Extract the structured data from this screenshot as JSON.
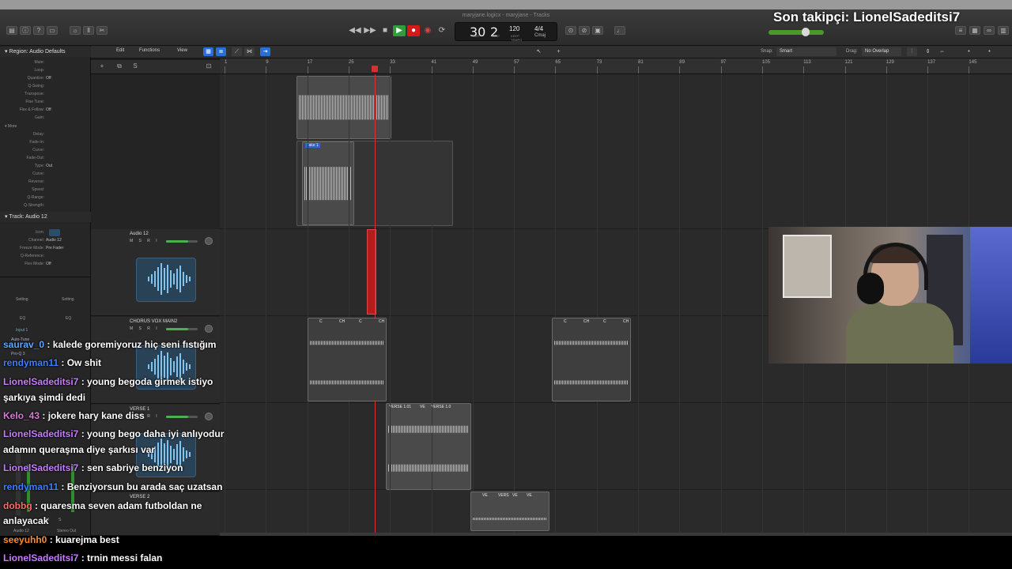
{
  "window": {
    "title": "maryjane.logicx - maryjane - Tracks",
    "apple_glyph": ""
  },
  "stream": {
    "follower_label": "Son takipçi: LionelSadeditsi7"
  },
  "lcd": {
    "bar": "30",
    "beat": "2",
    "bar_label": "BAR",
    "beat_label": "BEAT",
    "tempo": "120",
    "tempo_label": "KEEP",
    "tempo_sub": "TEMPO",
    "signature": "4/4",
    "key": "Cmaj"
  },
  "local_menu": {
    "edit": "Edit",
    "functions": "Functions",
    "view": "View",
    "snap_label": "Snap:",
    "snap_value": "Smart",
    "drag_label": "Drag:",
    "drag_value": "No Overlap"
  },
  "inspector": {
    "region_header": "Region: Audio Defaults",
    "region_rows": [
      {
        "k": "Mute:",
        "v": ""
      },
      {
        "k": "Loop:",
        "v": ""
      },
      {
        "k": "Quantize:",
        "v": "Off"
      },
      {
        "k": "Q-Swing:",
        "v": ""
      },
      {
        "k": "Transpose:",
        "v": ""
      },
      {
        "k": "Fine Tune:",
        "v": ""
      },
      {
        "k": "Flex & Follow:",
        "v": "Off"
      },
      {
        "k": "Gain:",
        "v": ""
      }
    ],
    "more": "More",
    "more_rows": [
      {
        "k": "Delay:",
        "v": ""
      },
      {
        "k": "Fade-In:",
        "v": ""
      },
      {
        "k": "Curve:",
        "v": ""
      },
      {
        "k": "Fade-Out:",
        "v": ""
      },
      {
        "k": "Type:",
        "v": "Out"
      },
      {
        "k": "Curve:",
        "v": ""
      },
      {
        "k": "Reverse:",
        "v": ""
      },
      {
        "k": "Speed:",
        "v": ""
      },
      {
        "k": "Q-Range:",
        "v": ""
      },
      {
        "k": "Q-Strength:",
        "v": ""
      }
    ],
    "track_header": "Track: Audio 12",
    "track_rows": [
      {
        "k": "Icon:",
        "v": ""
      },
      {
        "k": "Channel:",
        "v": "Audio 12"
      },
      {
        "k": "Freeze Mode:",
        "v": "Pre Fader"
      },
      {
        "k": "Q-Reference:",
        "v": ""
      },
      {
        "k": "Flex Mode:",
        "v": "Off"
      }
    ],
    "setting_left": "Setting",
    "setting_right": "Setting",
    "eq_left": "EQ",
    "eq_right": "EQ",
    "input": "Input 1",
    "plugin_1": "Auto-Tune",
    "plugin_2": "Pro-Q 3",
    "bottom_left": "Audio 12",
    "bottom_right": "Stereo Out",
    "m_label": "M",
    "s_label": "S"
  },
  "tracks": [
    {
      "name": "Audio 12",
      "msr": "M S R I"
    },
    {
      "name": "CHORUS VOX MAIN2",
      "msr": "M S R I"
    },
    {
      "name": "VERSE 1",
      "msr": "M S R I"
    },
    {
      "name": "VERSE 2",
      "msr": ""
    }
  ],
  "ruler": [
    "1",
    "9",
    "17",
    "25",
    "33",
    "41",
    "49",
    "57",
    "65",
    "73",
    "81",
    "89",
    "97",
    "105",
    "113",
    "121",
    "129",
    "137",
    "145"
  ],
  "regions": {
    "take": "Take 1",
    "chorus_labels": [
      "C",
      "CH",
      "C",
      "CH",
      "C",
      "CH",
      "C",
      "CH"
    ],
    "verse1_a": "VERSE 1.01",
    "verse1_b": "VE",
    "verse1_c": "VERSE 1.0",
    "verse2_labels": [
      "VE",
      "VERS",
      "VE",
      "VE"
    ]
  },
  "chat": [
    {
      "user": "saurav_0",
      "color": "#5fa8ff",
      "text": " : kalede goremiyoruz hiç seni fıstığım"
    },
    {
      "user": "rendyman11",
      "color": "#3f7fff",
      "text": " : Ow shit"
    },
    {
      "user": "LionelSadeditsi7",
      "color": "#c77dff",
      "text": " : young begoda girmek istiyo"
    },
    {
      "user": "",
      "color": "#ffffff",
      "text": "şarkıya şimdi dedi"
    },
    {
      "user": "Kelo_43",
      "color": "#d97ad9",
      "text": " : jokere hary kane diss"
    },
    {
      "user": "LionelSadeditsi7",
      "color": "#c77dff",
      "text": " : young bego daha iyi anlıyodur"
    },
    {
      "user": "",
      "color": "#ffffff",
      "text": "adamın queraşma diye şarkısı var"
    },
    {
      "user": "LionelSadeditsi7",
      "color": "#c77dff",
      "text": " : sen sabriye benziyon"
    },
    {
      "user": "rendyman11",
      "color": "#3f7fff",
      "text": " : Benziyorsun bu arada saç uzatsan"
    },
    {
      "user": "dobbg",
      "color": "#ff6a6a",
      "text": " : quaresma seven adam futboldan ne"
    },
    {
      "user": "",
      "color": "#ffffff",
      "text": "anlayacak"
    },
    {
      "user": "seeyuhh0",
      "color": "#ff8a2a",
      "text": " : kuarejma best"
    },
    {
      "user": "LionelSadeditsi7",
      "color": "#c77dff",
      "text": " : trnin messi falan"
    }
  ]
}
